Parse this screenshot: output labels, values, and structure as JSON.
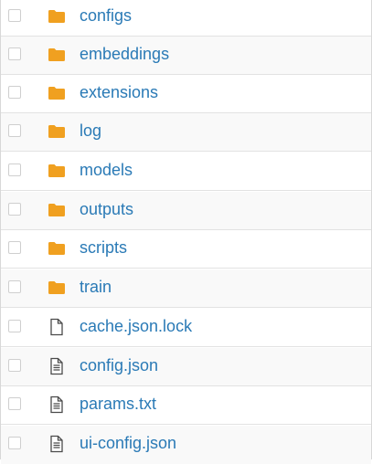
{
  "files": [
    {
      "name": "configs",
      "type": "folder",
      "icon": "folder-icon"
    },
    {
      "name": "embeddings",
      "type": "folder",
      "icon": "folder-icon"
    },
    {
      "name": "extensions",
      "type": "folder",
      "icon": "folder-icon"
    },
    {
      "name": "log",
      "type": "folder",
      "icon": "folder-icon"
    },
    {
      "name": "models",
      "type": "folder",
      "icon": "folder-icon"
    },
    {
      "name": "outputs",
      "type": "folder",
      "icon": "folder-icon"
    },
    {
      "name": "scripts",
      "type": "folder",
      "icon": "folder-icon"
    },
    {
      "name": "train",
      "type": "folder",
      "icon": "folder-icon"
    },
    {
      "name": "cache.json.lock",
      "type": "file",
      "icon": "file-icon"
    },
    {
      "name": "config.json",
      "type": "file",
      "icon": "file-text-icon"
    },
    {
      "name": "params.txt",
      "type": "file",
      "icon": "file-text-icon"
    },
    {
      "name": "ui-config.json",
      "type": "file",
      "icon": "file-text-icon"
    }
  ],
  "colors": {
    "link": "#2a7ab6",
    "folder": "#f0a020",
    "border": "#e2e2e2"
  }
}
